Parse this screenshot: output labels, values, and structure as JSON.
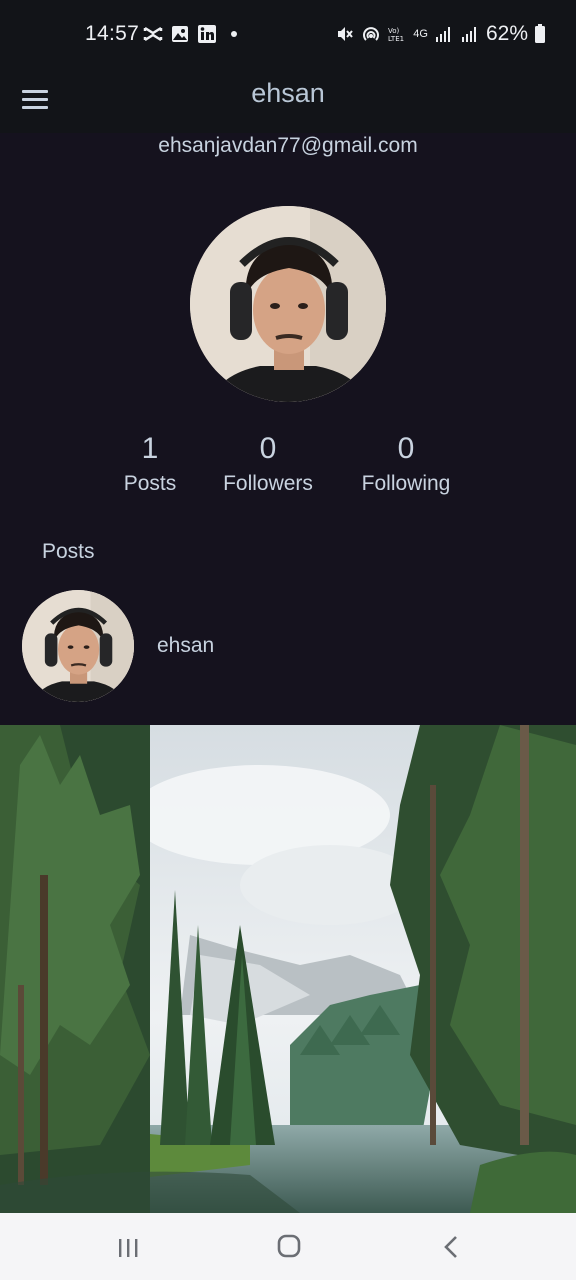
{
  "status_bar": {
    "time": "14:57",
    "battery": "62%",
    "network_label": "4G",
    "left_icons": [
      "capcut-icon",
      "gallery-icon",
      "linkedin-icon",
      "dot-icon"
    ],
    "right_icons": [
      "mute-icon",
      "hotspot-icon",
      "volte-icon",
      "signal-icon",
      "battery-icon"
    ]
  },
  "app_bar": {
    "title": "ehsan"
  },
  "profile": {
    "email": "ehsanjavdan77@gmail.com",
    "stats": [
      {
        "value": "1",
        "label": "Posts"
      },
      {
        "value": "0",
        "label": "Followers"
      },
      {
        "value": "0",
        "label": "Following"
      }
    ]
  },
  "posts_section": {
    "heading": "Posts",
    "post": {
      "username": "ehsan"
    }
  },
  "colors": {
    "background": "#15121e",
    "app_bar": "#121418",
    "text": "#c9d3e0",
    "nav_bar": "#f5f5f7"
  }
}
